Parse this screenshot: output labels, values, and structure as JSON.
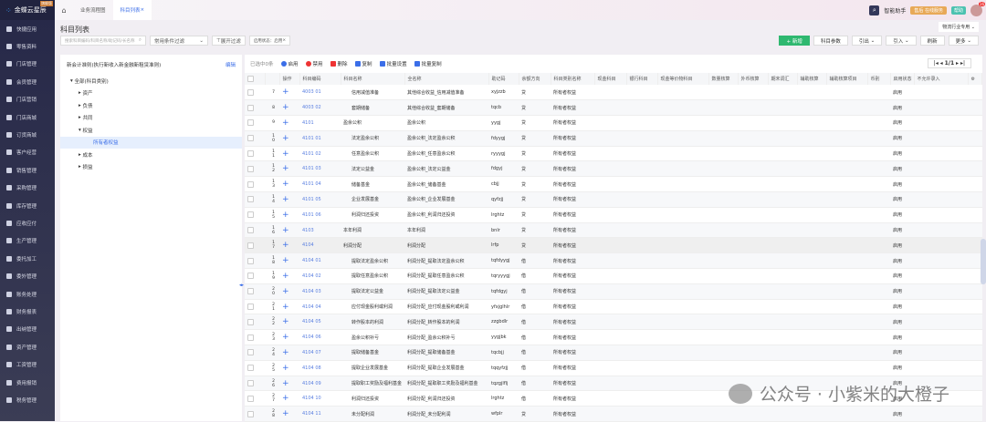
{
  "app": {
    "logo": "金蝶云星辰",
    "edition": "旗舰版"
  },
  "sidebar": {
    "items": [
      "快捷应用",
      "零售资料",
      "门店管理",
      "会员管理",
      "门店营销",
      "门店商城",
      "订货商城",
      "客户经营",
      "销售管理",
      "采购管理",
      "库存管理",
      "应收应付",
      "生产管理",
      "委托加工",
      "委外管理",
      "账务处理",
      "财务报表",
      "出纳管理",
      "资产管理",
      "工资管理",
      "费用报销",
      "税务管理"
    ]
  },
  "tabs": [
    {
      "label": "业务流程图"
    },
    {
      "label": "科目列表",
      "active": true
    }
  ],
  "topbar": {
    "assistant": "智能助手",
    "service": "售后 在线服务",
    "help": "帮助",
    "notifications": "16"
  },
  "page": {
    "title": "科目列表",
    "industry": "物流行业专用"
  },
  "filters": {
    "search_placeholder": "搜索科目编码/科目名称/助记码/长名称",
    "common": "常用条件过滤",
    "expand": "展开过滤",
    "status_tag": "启用状态：启用"
  },
  "actions": {
    "add": "+ 新增",
    "params": "科目参数",
    "export": "引出",
    "import": "引入",
    "refresh": "刷新",
    "more": "更多"
  },
  "tree": {
    "title": "新会计准则(执行新收入新金融新租赁准则)",
    "edit": "编辑",
    "root": "全部(科目类别)",
    "nodes": [
      "资产",
      "负债",
      "共同",
      "权益",
      "所有者权益",
      "成本",
      "损益"
    ]
  },
  "grid": {
    "selected": "已选中0条",
    "tools": [
      "启用",
      "禁用",
      "删除",
      "复制",
      "批量设置",
      "批量复制"
    ],
    "pager": "1/1",
    "columns": [
      "",
      "",
      "操作",
      "科目编码",
      "科目名称",
      "全名称",
      "助记码",
      "余额方向",
      "科目类别名称",
      "现金科目",
      "银行科目",
      "现金等价物科目",
      "数量核算",
      "外币核算",
      "期末调汇",
      "辅助核算",
      "辅助核算项目",
      "币别",
      "启用状态",
      "不允许录入"
    ],
    "rows": [
      [
        "7",
        "4003 01",
        "信用减值准备",
        "其他综合收益_信用减值准备",
        "xyjzzb",
        "贷",
        "所有者权益",
        "启用"
      ],
      [
        "8",
        "4003 02",
        "套期储备",
        "其他综合收益_套期储备",
        "tqcb",
        "贷",
        "所有者权益",
        "启用"
      ],
      [
        "9",
        "4101",
        "盈余公积",
        "盈余公积",
        "yygj",
        "贷",
        "所有者权益",
        "启用"
      ],
      [
        "10",
        "4101 01",
        "法定盈余公积",
        "盈余公积_法定盈余公积",
        "fdyygj",
        "贷",
        "所有者权益",
        "启用"
      ],
      [
        "11",
        "4101 02",
        "任意盈余公积",
        "盈余公积_任意盈余公积",
        "ryyygj",
        "贷",
        "所有者权益",
        "启用"
      ],
      [
        "12",
        "4101 03",
        "法定公益金",
        "盈余公积_法定公益金",
        "fdgyj",
        "贷",
        "所有者权益",
        "启用"
      ],
      [
        "13",
        "4101 04",
        "储备基金",
        "盈余公积_储备基金",
        "cbjj",
        "贷",
        "所有者权益",
        "启用"
      ],
      [
        "14",
        "4101 05",
        "企业发展基金",
        "盈余公积_企业发展基金",
        "qyfzjj",
        "贷",
        "所有者权益",
        "启用"
      ],
      [
        "15",
        "4101 06",
        "利润归还投资",
        "盈余公积_利润归还投资",
        "lrghtz",
        "贷",
        "所有者权益",
        "启用"
      ],
      [
        "16",
        "4103",
        "本年利润",
        "本年利润",
        "bnlr",
        "贷",
        "所有者权益",
        "启用"
      ],
      [
        "17",
        "4104",
        "利润分配",
        "利润分配",
        "lrfp",
        "贷",
        "所有者权益",
        "启用"
      ],
      [
        "18",
        "4104 01",
        "提取法定盈余公积",
        "利润分配_提取法定盈余公积",
        "tqfdyygj",
        "借",
        "所有者权益",
        "启用"
      ],
      [
        "19",
        "4104 02",
        "提取任意盈余公积",
        "利润分配_提取任意盈余公积",
        "tqryyygj",
        "借",
        "所有者权益",
        "启用"
      ],
      [
        "20",
        "4104 03",
        "提取法定公益金",
        "利润分配_提取法定公益金",
        "tqfdgyj",
        "借",
        "所有者权益",
        "启用"
      ],
      [
        "21",
        "4104 04",
        "应付现金股利或利润",
        "利润分配_应付现金股利或利润",
        "yfxjglhlr",
        "借",
        "所有者权益",
        "启用"
      ],
      [
        "22",
        "4104 05",
        "转作股本的利润",
        "利润分配_转作股本的利润",
        "zzgbdlr",
        "借",
        "所有者权益",
        "启用"
      ],
      [
        "23",
        "4104 06",
        "盈余公积补亏",
        "利润分配_盈余公积补亏",
        "yygjbk",
        "借",
        "所有者权益",
        "启用"
      ],
      [
        "24",
        "4104 07",
        "提取储备基金",
        "利润分配_提取储备基金",
        "tqcbjj",
        "借",
        "所有者权益",
        "启用"
      ],
      [
        "25",
        "4104 08",
        "提取企业发展基金",
        "利润分配_提取企业发展基金",
        "tqqyfzjj",
        "借",
        "所有者权益",
        "启用"
      ],
      [
        "26",
        "4104 09",
        "提取职工奖励及福利基金",
        "利润分配_提取职工奖励及福利基金",
        "tqzgjlflj",
        "借",
        "所有者权益",
        "启用"
      ],
      [
        "27",
        "4104 10",
        "利润归还投资",
        "利润分配_利润归还投资",
        "lrghtz",
        "借",
        "所有者权益",
        "启用"
      ],
      [
        "28",
        "4104 11",
        "未分配利润",
        "利润分配_未分配利润",
        "wfplr",
        "贷",
        "所有者权益",
        "启用"
      ]
    ]
  },
  "watermark": "公众号 · 小紫米的大橙子"
}
